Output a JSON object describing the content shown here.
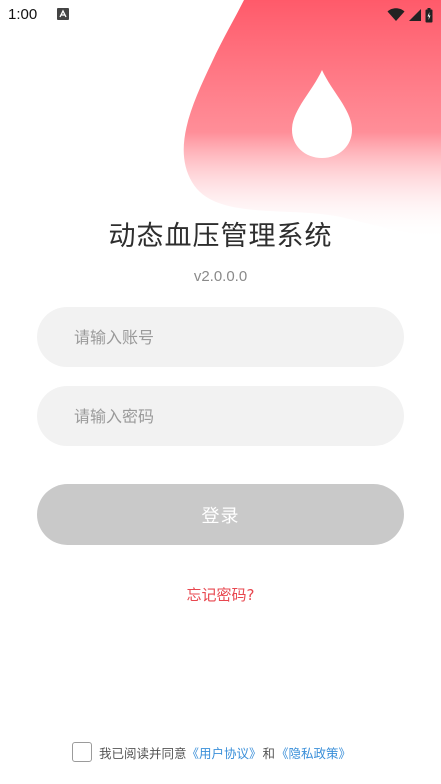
{
  "status_bar": {
    "time": "1:00"
  },
  "app": {
    "title": "动态血压管理系统",
    "version": "v2.0.0.0"
  },
  "form": {
    "account_placeholder": "请输入账号",
    "password_placeholder": "请输入密码",
    "login_label": "登录",
    "forgot_label": "忘记密码?"
  },
  "agreement": {
    "prefix": "我已阅读并同意",
    "user_agreement": "《用户协议》",
    "separator": "和",
    "privacy_policy": "《隐私政策》"
  },
  "icons": {
    "status_app": "android-debug-icon",
    "wifi": "wifi-icon",
    "signal": "cell-signal-icon",
    "battery": "battery-icon",
    "logo": "blood-drop-icon"
  },
  "colors": {
    "brand_gradient_start": "#ff5a6a",
    "brand_gradient_end": "#ffffff",
    "forgot_text": "#e8474f",
    "link_text": "#3a8fd9",
    "button_disabled": "#c9c9c9",
    "input_background": "#f2f2f2"
  }
}
